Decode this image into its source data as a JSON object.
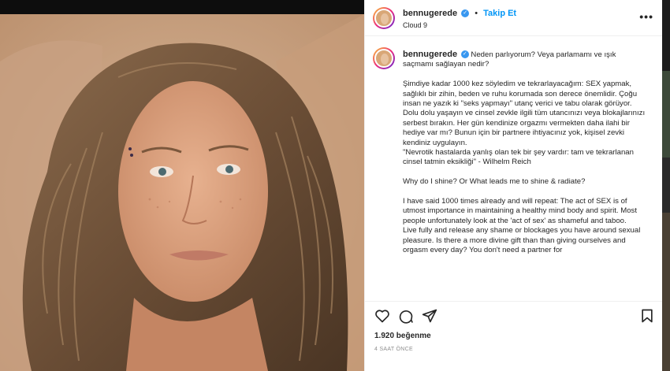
{
  "header": {
    "username": "bennugerede",
    "verified_icon": "verified-badge-icon",
    "separator": "•",
    "follow_label": "Takip Et",
    "location": "Cloud 9",
    "more_label": "•••"
  },
  "caption": {
    "username": "bennugerede",
    "lines_tr": [
      "Neden parlıyorum? Veya parlamamı ve ışık saçmamı sağlayan nedir?",
      "Şimdiye kadar 1000 kez söyledim ve tekrarlayacağım: SEX yapmak, sağlıklı bir zihin, beden ve ruhu korumada son derece önemlidir. Çoğu insan ne yazık ki \"seks yapmayı\" utanç verici ve tabu olarak görüyor.",
      "Dolu dolu yaşayın ve cinsel zevkle ilgili tüm utancınızı veya blokajlarınızı serbest bırakın. Her gün kendinize orgazmı vermekten daha ilahi bir hediye var mı? Bunun için bir partnere ihtiyacınız yok, kişisel zevki kendiniz uygulayın.",
      "\"Nevrotik hastalarda yanlış olan tek bir şey vardır: tam ve tekrarlanan cinsel tatmin eksikliği\" - Wilhelm Reich"
    ],
    "lines_en": [
      "Why do I shine? Or What leads me to shine & radiate?",
      "I have said 1000 times already and will repeat: The act of SEX is of utmost importance in maintaining a healthy mind body and spirit. Most people unfortunately look at the 'act of sex' as shameful and taboo.",
      "Live fully and release any shame or blockages you have around sexual pleasure. Is there a more divine gift than than giving ourselves and orgasm every day? You don't need a partner for"
    ]
  },
  "actions": {
    "like_icon": "heart-icon",
    "comment_icon": "comment-icon",
    "share_icon": "share-icon",
    "save_icon": "bookmark-icon"
  },
  "likes": "1.920 beğenme",
  "time": "4 SAAT ÖNCE",
  "colors": {
    "accent": "#0095f6",
    "verified": "#3897f0",
    "text": "#262626",
    "muted": "#8e8e8e"
  }
}
